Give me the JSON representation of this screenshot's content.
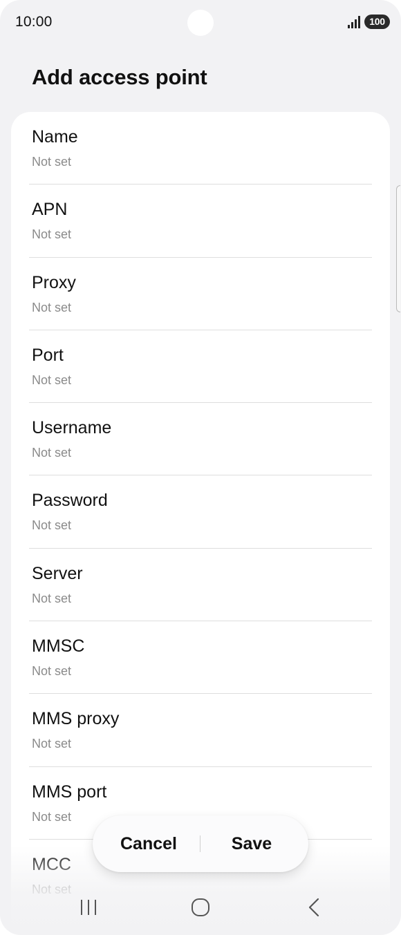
{
  "status_bar": {
    "time": "10:00",
    "battery": "100",
    "icons": [
      "signal-icon",
      "battery-icon"
    ]
  },
  "header": {
    "title": "Add access point"
  },
  "settings": [
    {
      "title": "Name",
      "value": "Not set"
    },
    {
      "title": "APN",
      "value": "Not set"
    },
    {
      "title": "Proxy",
      "value": "Not set"
    },
    {
      "title": "Port",
      "value": "Not set"
    },
    {
      "title": "Username",
      "value": "Not set"
    },
    {
      "title": "Password",
      "value": "Not set"
    },
    {
      "title": "Server",
      "value": "Not set"
    },
    {
      "title": "MMSC",
      "value": "Not set"
    },
    {
      "title": "MMS proxy",
      "value": "Not set"
    },
    {
      "title": "MMS port",
      "value": "Not set"
    },
    {
      "title": "MCC",
      "value": "Not set"
    }
  ],
  "actions": {
    "cancel_label": "Cancel",
    "save_label": "Save"
  },
  "nav_bar": {
    "icons": [
      "recents-icon",
      "home-icon",
      "back-icon"
    ]
  },
  "colors": {
    "background": "#f2f2f4",
    "card": "#ffffff",
    "primary_text": "#111111",
    "secondary_text": "#8a8a8a"
  }
}
